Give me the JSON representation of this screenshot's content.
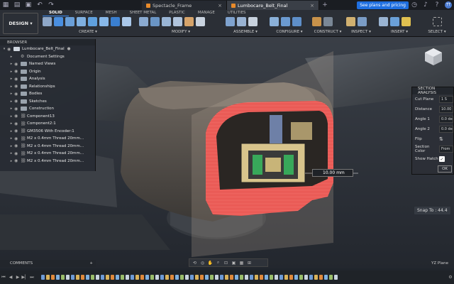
{
  "titlebar": {
    "tabs": [
      {
        "label": "Spectacle_Frame",
        "active": false
      },
      {
        "label": "Lumbocare_Belt_Final",
        "active": true
      }
    ],
    "plan_button": "See plans and pricing",
    "user_initials": "TT"
  },
  "toolbar": {
    "workspace": "DESIGN",
    "tabs": [
      "SOLID",
      "SURFACE",
      "MESH",
      "SHEET METAL",
      "PLASTIC",
      "MANAGE",
      "UTILITIES"
    ],
    "active_tab": "SOLID",
    "groups": [
      "CREATE",
      "MODIFY",
      "ASSEMBLE",
      "CONFIGURE",
      "CONSTRUCT",
      "INSPECT",
      "INSERT",
      "SELECT"
    ]
  },
  "browser": {
    "title": "BROWSER",
    "root": "Lumbocare_Belt_Final",
    "items": [
      {
        "label": "Document Settings",
        "kind": "gear"
      },
      {
        "label": "Named Views",
        "kind": "folder"
      },
      {
        "label": "Origin",
        "kind": "folder"
      },
      {
        "label": "Analysis",
        "kind": "folder"
      },
      {
        "label": "Relationships",
        "kind": "folder"
      },
      {
        "label": "Bodies",
        "kind": "folder"
      },
      {
        "label": "Sketches",
        "kind": "folder"
      },
      {
        "label": "Construction",
        "kind": "folder"
      },
      {
        "label": "Component13",
        "kind": "link"
      },
      {
        "label": "Component2:1",
        "kind": "link"
      },
      {
        "label": "GM3506 With Encoder:1",
        "kind": "link"
      },
      {
        "label": "M2 x 0.4mm Thread 20mm...",
        "kind": "link"
      },
      {
        "label": "M2 x 0.4mm Thread 20mm...",
        "kind": "link"
      },
      {
        "label": "M2 x 0.4mm Thread 20mm...",
        "kind": "link"
      },
      {
        "label": "M2 x 0.4mm Thread 20mm...",
        "kind": "link"
      }
    ]
  },
  "section_analysis": {
    "title": "SECTION ANALYSIS",
    "rows": [
      {
        "label": "Cut Plane",
        "value": "1 S"
      },
      {
        "label": "Distance",
        "value": "10.00"
      },
      {
        "label": "Angle 1",
        "value": "0.0 de"
      },
      {
        "label": "Angle 2",
        "value": "0.0 de"
      },
      {
        "label": "Flip",
        "value": ""
      },
      {
        "label": "Section Color",
        "value": "From"
      },
      {
        "label": "Show Hatch",
        "value": ""
      }
    ],
    "ok_label": "OK"
  },
  "viewport": {
    "dimension_value": "10.00 mm",
    "snap_text": "Snap To : 44.4",
    "plane_label": "YZ Plane"
  },
  "comments": {
    "label": "COMMENTS"
  },
  "colors": {
    "accent": "#1f6fe0",
    "hatch": "#e8504e",
    "body": "#9b8a7a"
  }
}
